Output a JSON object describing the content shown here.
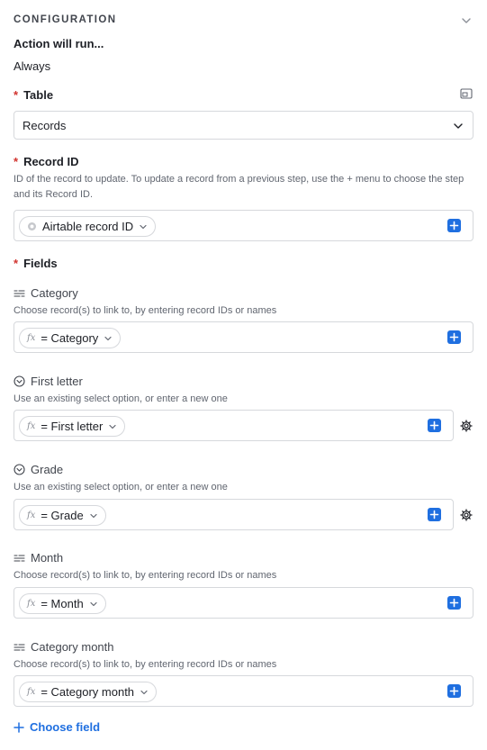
{
  "section": {
    "title": "CONFIGURATION",
    "run_label": "Action will run...",
    "run_value": "Always"
  },
  "required_mark": "*",
  "table": {
    "label": "Table",
    "value": "Records"
  },
  "record_id": {
    "label": "Record ID",
    "help": "ID of the record to update. To update a record from a previous step, use the + menu to choose the step and its Record ID.",
    "token": "Airtable record ID"
  },
  "fields": {
    "label": "Fields",
    "items": [
      {
        "name": "Category",
        "icon": "link-icon",
        "help": "Choose record(s) to link to, by entering record IDs or names",
        "token": "= Category",
        "fx": "fx"
      },
      {
        "name": "First letter",
        "icon": "single-select-icon",
        "help": "Use an existing select option, or enter a new one",
        "token": "= First letter",
        "fx": "fx"
      },
      {
        "name": "Grade",
        "icon": "single-select-icon",
        "help": "Use an existing select option, or enter a new one",
        "token": "= Grade",
        "fx": "fx"
      },
      {
        "name": "Month",
        "icon": "link-icon",
        "help": "Choose record(s) to link to, by entering record IDs or names",
        "token": "= Month",
        "fx": "fx"
      },
      {
        "name": "Category month",
        "icon": "link-icon",
        "help": "Choose record(s) to link to, by entering record IDs or names",
        "token": "= Category month",
        "fx": "fx"
      }
    ]
  },
  "choose_field": "Choose field",
  "colors": {
    "accent": "#1f6fe0",
    "required": "#d1332e",
    "border": "#d6d8dc"
  }
}
